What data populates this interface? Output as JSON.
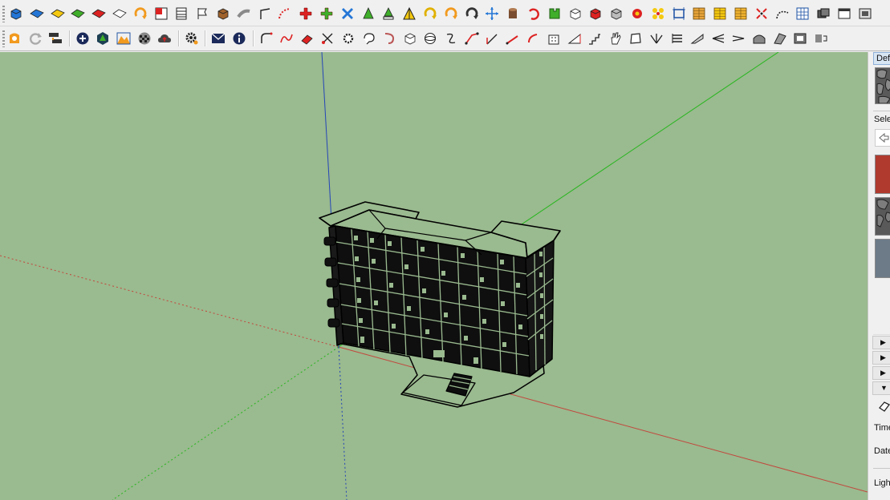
{
  "toolbar_top": {
    "tools": [
      "paint-blue-icon",
      "face-blue-icon",
      "face-yellow-icon",
      "face-green-icon",
      "face-red-icon",
      "face-outline-icon",
      "arc-orange-icon",
      "square-red-icon",
      "rows-icon",
      "flag-icon",
      "box-brown-icon",
      "pipe-gray-icon",
      "corner-line-icon",
      "dotted-arc-icon",
      "cross-red-icon",
      "cross-green-icon",
      "cross-blue-icon",
      "cone-green-icon",
      "cone-tree-icon",
      "triangle-yellow-icon",
      "rotate-yellow-icon",
      "rotate-orange-icon",
      "rotate-gray-icon",
      "move-arrows-icon",
      "cylinder-icon",
      "undo-red-icon",
      "puzzle-green-icon",
      "cube-orange-icon",
      "cube-red-icon",
      "cube-gray-icon",
      "flower-red-icon",
      "flower-yellow-icon",
      "frame-blue-icon",
      "grid-orange-icon",
      "grid-yellow-icon",
      "grid-orange2-icon",
      "scatter-red-icon",
      "dotted-curve-icon",
      "grid-blue-icon",
      "layers-dark-icon",
      "window-icon",
      "window2-icon"
    ]
  },
  "toolbar_bottom": {
    "tools": [
      "extension-warehouse-icon",
      "refresh-icon",
      "layout-transfer-icon",
      "add-location-icon",
      "preview-3d-icon",
      "terrain-icon",
      "checker-icon",
      "cloud-upload-icon",
      "settings-icon",
      "email-icon",
      "info-icon",
      "curve-tool-icon",
      "spline-red-icon",
      "eraser-icon",
      "scissors-icon",
      "gear-gray-icon",
      "lasso-icon",
      "hook-icon",
      "box-outline-icon",
      "sphere-icon",
      "s-curve-icon",
      "angle-red-icon",
      "angle-line-icon",
      "arrow-red-icon",
      "bracket-red-icon",
      "building-icon",
      "ramp-icon",
      "stairs-icon",
      "hand-icon",
      "shape-icon",
      "fan-icon",
      "stack-icon",
      "slope-icon",
      "split-icon",
      "split2-icon",
      "vault-icon",
      "ridge-icon",
      "shelf-icon",
      "more-icon"
    ]
  },
  "model_info": {
    "tray_section_default": "Default",
    "tray_selection_label": "Select",
    "tray_time_label": "Time",
    "tray_date_label": "Date",
    "tray_light_label": "Light"
  },
  "colors": {
    "viewport_bg": "#9aba8f",
    "axis_red": "#c2473d",
    "axis_green": "#26b71e",
    "axis_blue": "#2445b8"
  }
}
